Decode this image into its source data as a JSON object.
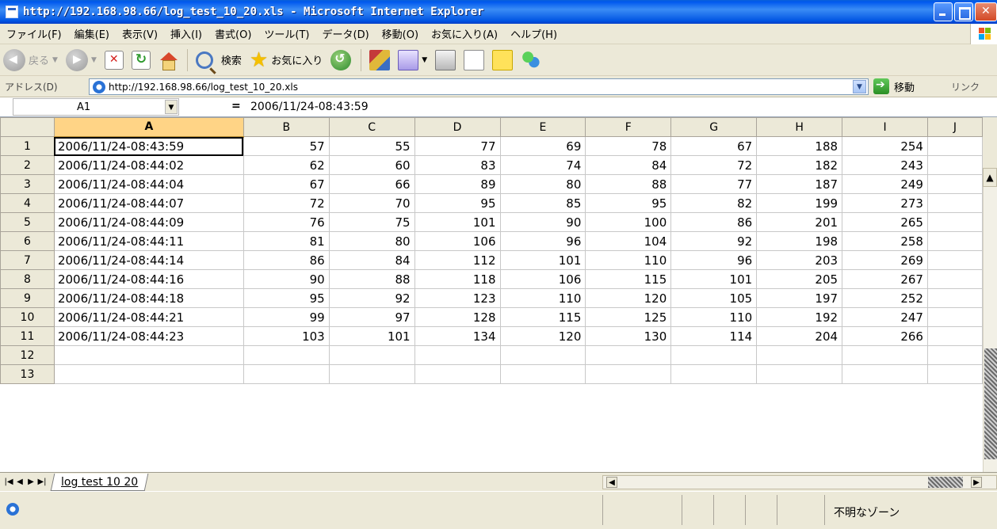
{
  "window": {
    "title": "http://192.168.98.66/log_test_10_20.xls - Microsoft Internet Explorer"
  },
  "menu": [
    "ファイル(F)",
    "編集(E)",
    "表示(V)",
    "挿入(I)",
    "書式(O)",
    "ツール(T)",
    "データ(D)",
    "移動(O)",
    "お気に入り(A)",
    "ヘルプ(H)"
  ],
  "toolbar": {
    "back_label": "戻る",
    "search_label": "検索",
    "favorites_label": "お気に入り"
  },
  "address": {
    "label": "アドレス(D)",
    "url": "http://192.168.98.66/log_test_10_20.xls",
    "go_label": "移動",
    "links_label": "リンク"
  },
  "formula": {
    "cell_ref": "A1",
    "equals": "=",
    "value": "2006/11/24-08:43:59"
  },
  "sheet": {
    "columns": [
      "A",
      "B",
      "C",
      "D",
      "E",
      "F",
      "G",
      "H",
      "I",
      "J"
    ],
    "rows": [
      {
        "n": "1",
        "ts": "2006/11/24-08:43:59",
        "v": [
          "57",
          "55",
          "77",
          "69",
          "78",
          "67",
          "188",
          "254"
        ]
      },
      {
        "n": "2",
        "ts": "2006/11/24-08:44:02",
        "v": [
          "62",
          "60",
          "83",
          "74",
          "84",
          "72",
          "182",
          "243"
        ]
      },
      {
        "n": "3",
        "ts": "2006/11/24-08:44:04",
        "v": [
          "67",
          "66",
          "89",
          "80",
          "88",
          "77",
          "187",
          "249"
        ]
      },
      {
        "n": "4",
        "ts": "2006/11/24-08:44:07",
        "v": [
          "72",
          "70",
          "95",
          "85",
          "95",
          "82",
          "199",
          "273"
        ]
      },
      {
        "n": "5",
        "ts": "2006/11/24-08:44:09",
        "v": [
          "76",
          "75",
          "101",
          "90",
          "100",
          "86",
          "201",
          "265"
        ]
      },
      {
        "n": "6",
        "ts": "2006/11/24-08:44:11",
        "v": [
          "81",
          "80",
          "106",
          "96",
          "104",
          "92",
          "198",
          "258"
        ]
      },
      {
        "n": "7",
        "ts": "2006/11/24-08:44:14",
        "v": [
          "86",
          "84",
          "112",
          "101",
          "110",
          "96",
          "203",
          "269"
        ]
      },
      {
        "n": "8",
        "ts": "2006/11/24-08:44:16",
        "v": [
          "90",
          "88",
          "118",
          "106",
          "115",
          "101",
          "205",
          "267"
        ]
      },
      {
        "n": "9",
        "ts": "2006/11/24-08:44:18",
        "v": [
          "95",
          "92",
          "123",
          "110",
          "120",
          "105",
          "197",
          "252"
        ]
      },
      {
        "n": "10",
        "ts": "2006/11/24-08:44:21",
        "v": [
          "99",
          "97",
          "128",
          "115",
          "125",
          "110",
          "192",
          "247"
        ]
      },
      {
        "n": "11",
        "ts": "2006/11/24-08:44:23",
        "v": [
          "103",
          "101",
          "134",
          "120",
          "130",
          "114",
          "204",
          "266"
        ]
      },
      {
        "n": "12",
        "ts": "",
        "v": [
          "",
          "",
          "",
          "",
          "",
          "",
          "",
          ""
        ]
      },
      {
        "n": "13",
        "ts": "",
        "v": [
          "",
          "",
          "",
          "",
          "",
          "",
          "",
          ""
        ]
      }
    ],
    "tab_name": "log test 10 20"
  },
  "status": {
    "zone": "不明なゾーン"
  }
}
